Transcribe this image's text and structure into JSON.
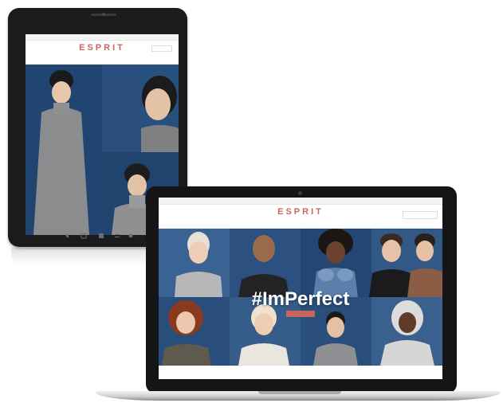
{
  "tablet": {
    "topbar_flag": "",
    "topbar_right": "",
    "logo": "ESPRIT",
    "nav": [
      "",
      "",
      "",
      "",
      "",
      "",
      "",
      ""
    ],
    "hero_text": ""
  },
  "laptop": {
    "topbar_flag": "",
    "topbar_links": [
      "",
      "",
      ""
    ],
    "logo": "ESPRIT",
    "search_placeholder": "",
    "nav": [
      "",
      "",
      "",
      "",
      "",
      "",
      "",
      ""
    ],
    "hero_hashtag": "#ImPerfect",
    "hero_button": ""
  },
  "colors": {
    "brand": "#c9665c",
    "hero_blue": "#2c5080",
    "device_black": "#151517"
  }
}
